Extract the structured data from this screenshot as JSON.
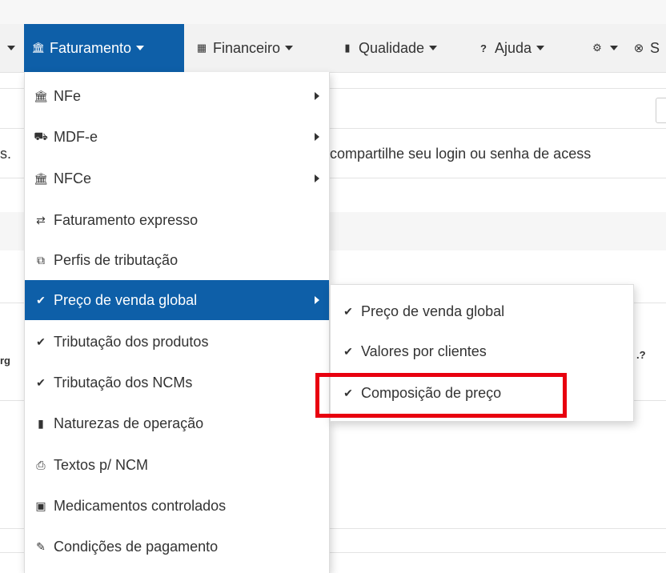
{
  "nav": {
    "faturamento": {
      "label": "Faturamento",
      "icon": "bank-icon"
    },
    "financeiro": {
      "label": "Financeiro",
      "icon": "table-icon"
    },
    "qualidade": {
      "label": "Qualidade",
      "icon": "book-icon"
    },
    "ajuda": {
      "label": "Ajuda",
      "icon": "question-icon"
    },
    "settings": {
      "icon": "gear-icon"
    },
    "exit": {
      "label": "S",
      "icon": "circle-x-icon"
    }
  },
  "background": {
    "left_text": "s.",
    "right_text": "compartilhe seu login ou senha de acess",
    "col_left": "rg",
    "col_right": ".?"
  },
  "menu": {
    "items": [
      {
        "label": "NFe",
        "icon": "bank-icon",
        "has_submenu": true
      },
      {
        "label": "MDF-e",
        "icon": "truck-icon",
        "has_submenu": true
      },
      {
        "label": "NFCe",
        "icon": "bank-icon",
        "has_submenu": true
      },
      {
        "label": "Faturamento expresso",
        "icon": "transfer-icon",
        "has_submenu": false
      },
      {
        "label": "Perfis de tributação",
        "icon": "tags-icon",
        "has_submenu": false
      },
      {
        "label": "Preço de venda global",
        "icon": "check-icon",
        "has_submenu": true,
        "active": true
      },
      {
        "label": "Tributação dos produtos",
        "icon": "check-icon",
        "has_submenu": false
      },
      {
        "label": "Tributação dos NCMs",
        "icon": "check-icon",
        "has_submenu": false
      },
      {
        "label": "Naturezas de operação",
        "icon": "book-icon",
        "has_submenu": false
      },
      {
        "label": "Textos p/ NCM",
        "icon": "clipboard-icon",
        "has_submenu": false
      },
      {
        "label": "Medicamentos controlados",
        "icon": "medkit-icon",
        "has_submenu": false
      },
      {
        "label": "Condições de pagamento",
        "icon": "pencil-icon",
        "has_submenu": false
      }
    ]
  },
  "submenu": {
    "items": [
      {
        "label": "Preço de venda global",
        "icon": "check-icon"
      },
      {
        "label": "Valores por clientes",
        "icon": "check-icon"
      },
      {
        "label": "Composição de preço",
        "icon": "check-icon",
        "highlighted": true
      }
    ]
  },
  "colors": {
    "active_bg": "#0e5fa8",
    "highlight_border": "#e8000f"
  }
}
